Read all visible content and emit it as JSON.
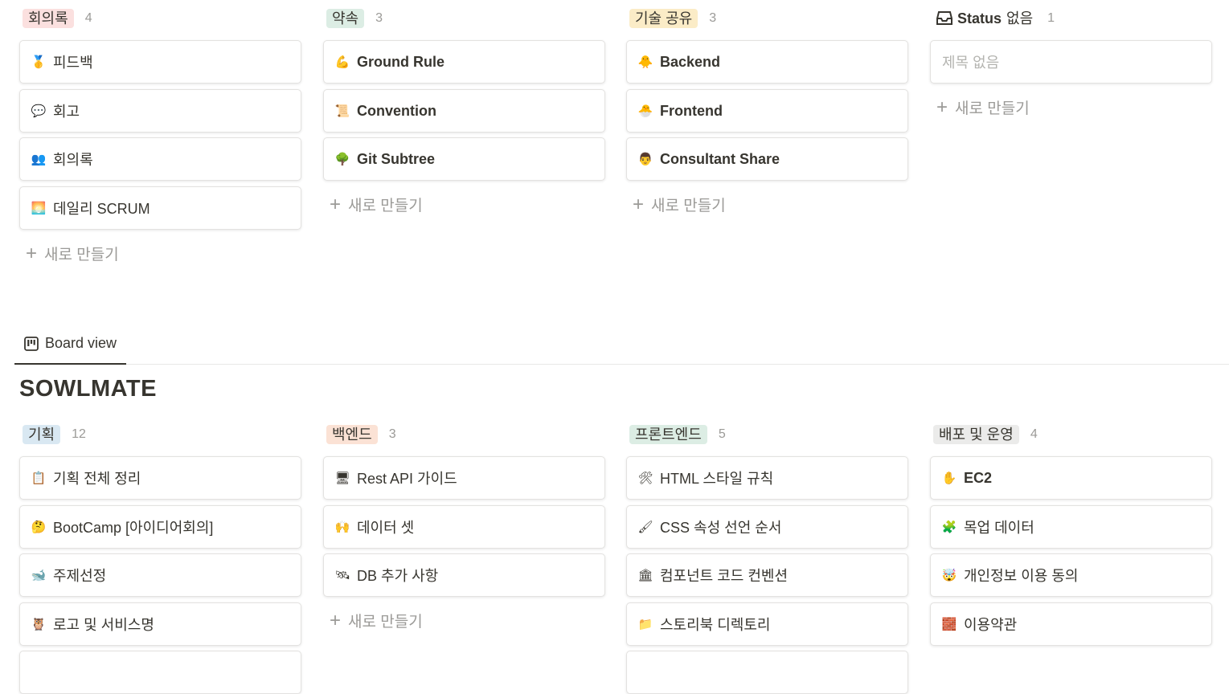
{
  "top_board": {
    "columns": [
      {
        "label": "회의록",
        "count": "4",
        "color": "#fbe0df",
        "cards": [
          {
            "icon": "medal-icon",
            "glyph": "🥇",
            "title": "피드백"
          },
          {
            "icon": "speech-bubble-icon",
            "glyph": "💬",
            "title": "회고"
          },
          {
            "icon": "people-icon",
            "glyph": "👥",
            "title": "회의록"
          },
          {
            "icon": "sunrise-icon",
            "glyph": "🌅",
            "title": "데일리 SCRUM"
          }
        ],
        "new_label": "새로 만들기"
      },
      {
        "label": "약속",
        "count": "3",
        "color": "#dcede4",
        "cards": [
          {
            "icon": "flexed-arm-icon",
            "glyph": "💪",
            "title": "Ground Rule"
          },
          {
            "icon": "scroll-icon",
            "glyph": "📜",
            "title": "Convention"
          },
          {
            "icon": "tree-icon",
            "glyph": "🌳",
            "title": "Git Subtree"
          }
        ],
        "new_label": "새로 만들기"
      },
      {
        "label": "기술 공유",
        "count": "3",
        "color": "#fbecc7",
        "cards": [
          {
            "icon": "chick-icon",
            "glyph": "🐥",
            "title": "Backend"
          },
          {
            "icon": "hatching-chick-icon",
            "glyph": "🐣",
            "title": "Frontend"
          },
          {
            "icon": "teacher-icon",
            "glyph": "🧑‍🏫",
            "title": "Consultant Share"
          }
        ],
        "new_label": "새로 만들기"
      },
      {
        "label": "Status",
        "label_suffix": "없음",
        "count": "1",
        "color": "",
        "cards": [
          {
            "icon": "",
            "glyph": "",
            "title": "제목 없음",
            "empty": true
          }
        ],
        "new_label": "새로 만들기"
      }
    ]
  },
  "tab": {
    "label": "Board view"
  },
  "page_title": "SOWLMATE",
  "bottom_board": {
    "columns": [
      {
        "label": "기획",
        "count": "12",
        "color": "#d9e8f2",
        "cards": [
          {
            "icon": "clipboard-icon",
            "glyph": "📋",
            "title": "기획 전체 정리"
          },
          {
            "icon": "thinking-face-icon",
            "glyph": "🤔",
            "title": "BootCamp [아이디어회의]"
          },
          {
            "icon": "whale-icon",
            "glyph": "🐋",
            "title": "주제선정"
          },
          {
            "icon": "owl-icon",
            "glyph": "🦉",
            "title": "로고 및 서비스명"
          }
        ]
      },
      {
        "label": "백엔드",
        "count": "3",
        "color": "#fbe2d5",
        "cards": [
          {
            "icon": "monitor-icon",
            "glyph": "🖥",
            "title": "Rest API 가이드"
          },
          {
            "icon": "raised-hands-icon",
            "glyph": "🙌",
            "title": "데이터 셋"
          },
          {
            "icon": "satellite-icon",
            "glyph": "🛰",
            "title": "DB 추가 사항"
          }
        ],
        "new_label": "새로 만들기"
      },
      {
        "label": "프론트엔드",
        "count": "5",
        "color": "#dcede4",
        "cards": [
          {
            "icon": "tools-icon",
            "glyph": "🛠",
            "title": "HTML 스타일 규칙"
          },
          {
            "icon": "paintbrush-icon",
            "glyph": "🖌",
            "title": "CSS 속성 선언 순서"
          },
          {
            "icon": "bank-icon",
            "glyph": "🏛",
            "title": "컴포넌트 코드 컨벤션"
          },
          {
            "icon": "folder-icon",
            "glyph": "📁",
            "title": "스토리북 디렉토리"
          }
        ]
      },
      {
        "label": "배포 및 운영",
        "count": "4",
        "color": "#ebebea",
        "cards": [
          {
            "icon": "hand-icon",
            "glyph": "✋",
            "title": "EC2"
          },
          {
            "icon": "puzzle-icon",
            "glyph": "🧩",
            "title": "목업 데이터"
          },
          {
            "icon": "shocked-face-icon",
            "glyph": "🤯",
            "title": "개인정보 이용 동의"
          },
          {
            "icon": "brick-icon",
            "glyph": "🧱",
            "title": "이용약관"
          }
        ]
      }
    ]
  }
}
